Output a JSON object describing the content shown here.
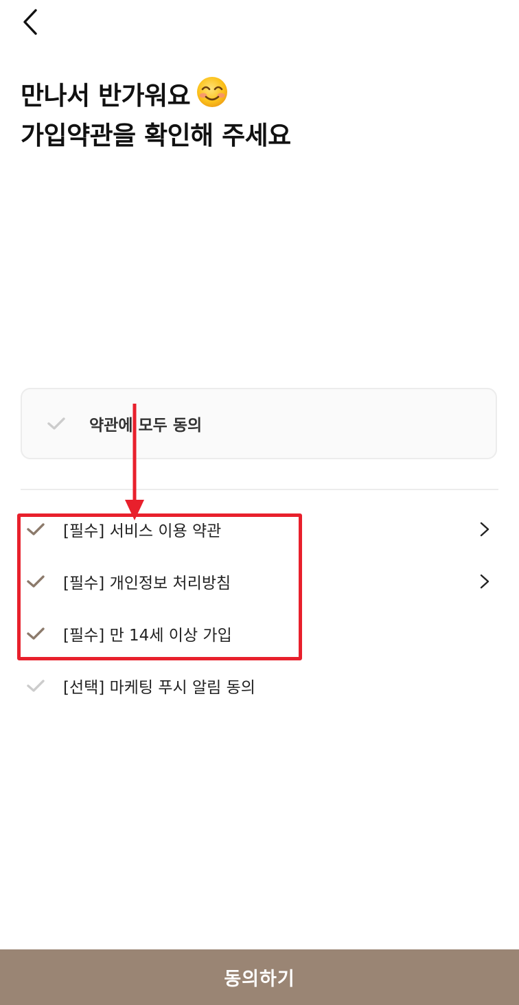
{
  "header": {
    "back_icon": "chevron-left-icon",
    "title_line1": "만나서 반가워요",
    "title_emoji": "smiling-face-icon",
    "title_line2": "가입약관을 확인해 주세요"
  },
  "agree_all": {
    "label": "약관에 모두 동의",
    "checked": false
  },
  "terms": [
    {
      "label": "[필수] 서비스 이용 약관",
      "checked": true,
      "has_detail": true
    },
    {
      "label": "[필수] 개인정보 처리방침",
      "checked": true,
      "has_detail": true
    },
    {
      "label": "[필수] 만 14세 이상 가입",
      "checked": true,
      "has_detail": false
    },
    {
      "label": "[선택] 마케팅 푸시 알림 동의",
      "checked": false,
      "has_detail": false
    }
  ],
  "footer": {
    "agree_button": "동의하기"
  },
  "colors": {
    "accent": "#9a8574",
    "check_on": "#8c7a6b",
    "check_off": "#cccccc",
    "annotation": "#e8202c"
  }
}
